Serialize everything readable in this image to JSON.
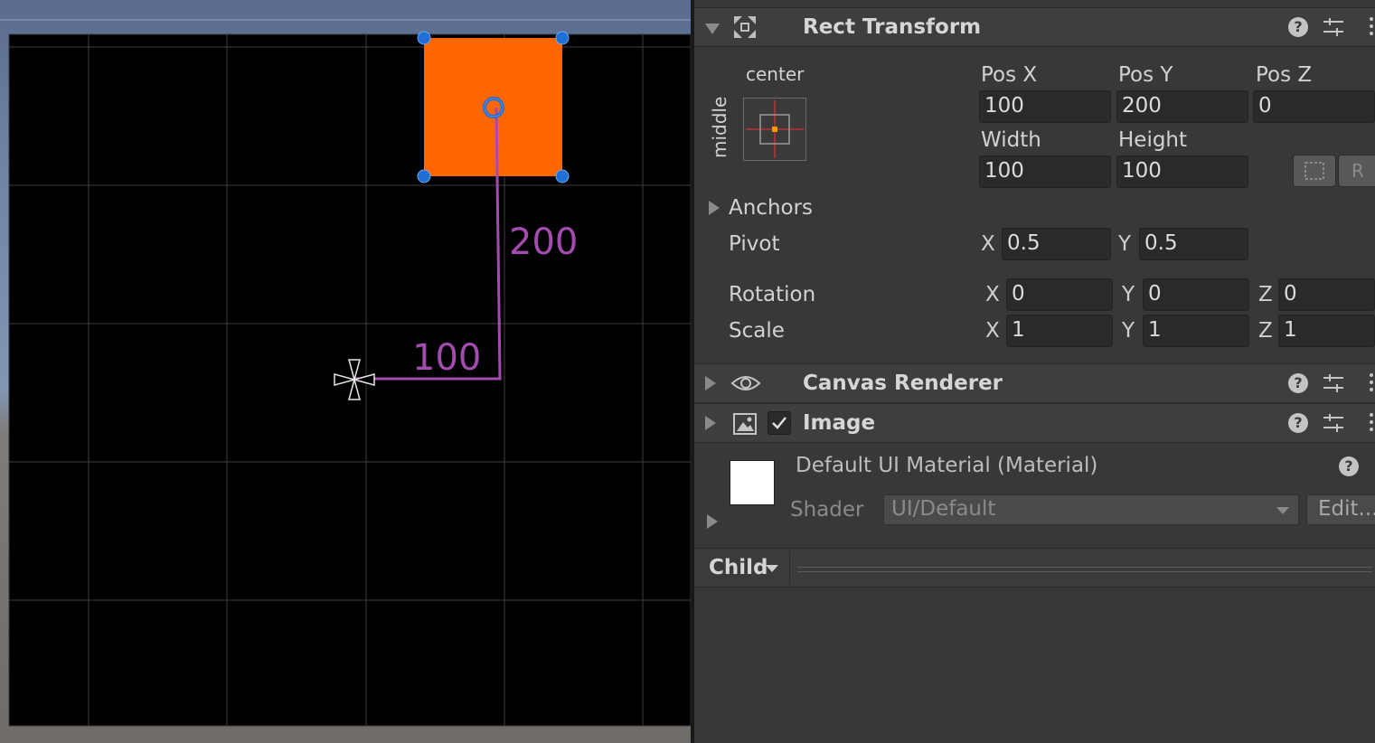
{
  "scene": {
    "pos_x_label": "100",
    "pos_y_label": "200"
  },
  "rect_transform": {
    "title": "Rect Transform",
    "anchor_preset_top": "center",
    "anchor_preset_side": "middle",
    "pos_x_label": "Pos X",
    "pos_y_label": "Pos Y",
    "pos_z_label": "Pos Z",
    "pos_x": "100",
    "pos_y": "200",
    "pos_z": "0",
    "width_label": "Width",
    "height_label": "Height",
    "width": "100",
    "height": "100",
    "raw_edit_label": "R",
    "anchors_label": "Anchors",
    "pivot_label": "Pivot",
    "pivot_x": "0.5",
    "pivot_y": "0.5",
    "rotation_label": "Rotation",
    "rotation_x": "0",
    "rotation_y": "0",
    "rotation_z": "0",
    "scale_label": "Scale",
    "scale_x": "1",
    "scale_y": "1",
    "scale_z": "1",
    "axis_x": "X",
    "axis_y": "Y",
    "axis_z": "Z"
  },
  "canvas_renderer": {
    "title": "Canvas Renderer"
  },
  "image": {
    "title": "Image",
    "enabled": true
  },
  "material": {
    "name": "Default UI Material (Material)",
    "shader_label": "Shader",
    "shader_value": "UI/Default",
    "edit_label": "Edit..."
  },
  "child": {
    "label": "Child"
  },
  "icons": {
    "help": "?"
  },
  "colors": {
    "object_fill": "#ff6600",
    "handle": "#1f6fd6",
    "measure_line": "#a44bb0",
    "anchor_cross": "#c0303a",
    "pivot_dot": "#e8a000"
  }
}
